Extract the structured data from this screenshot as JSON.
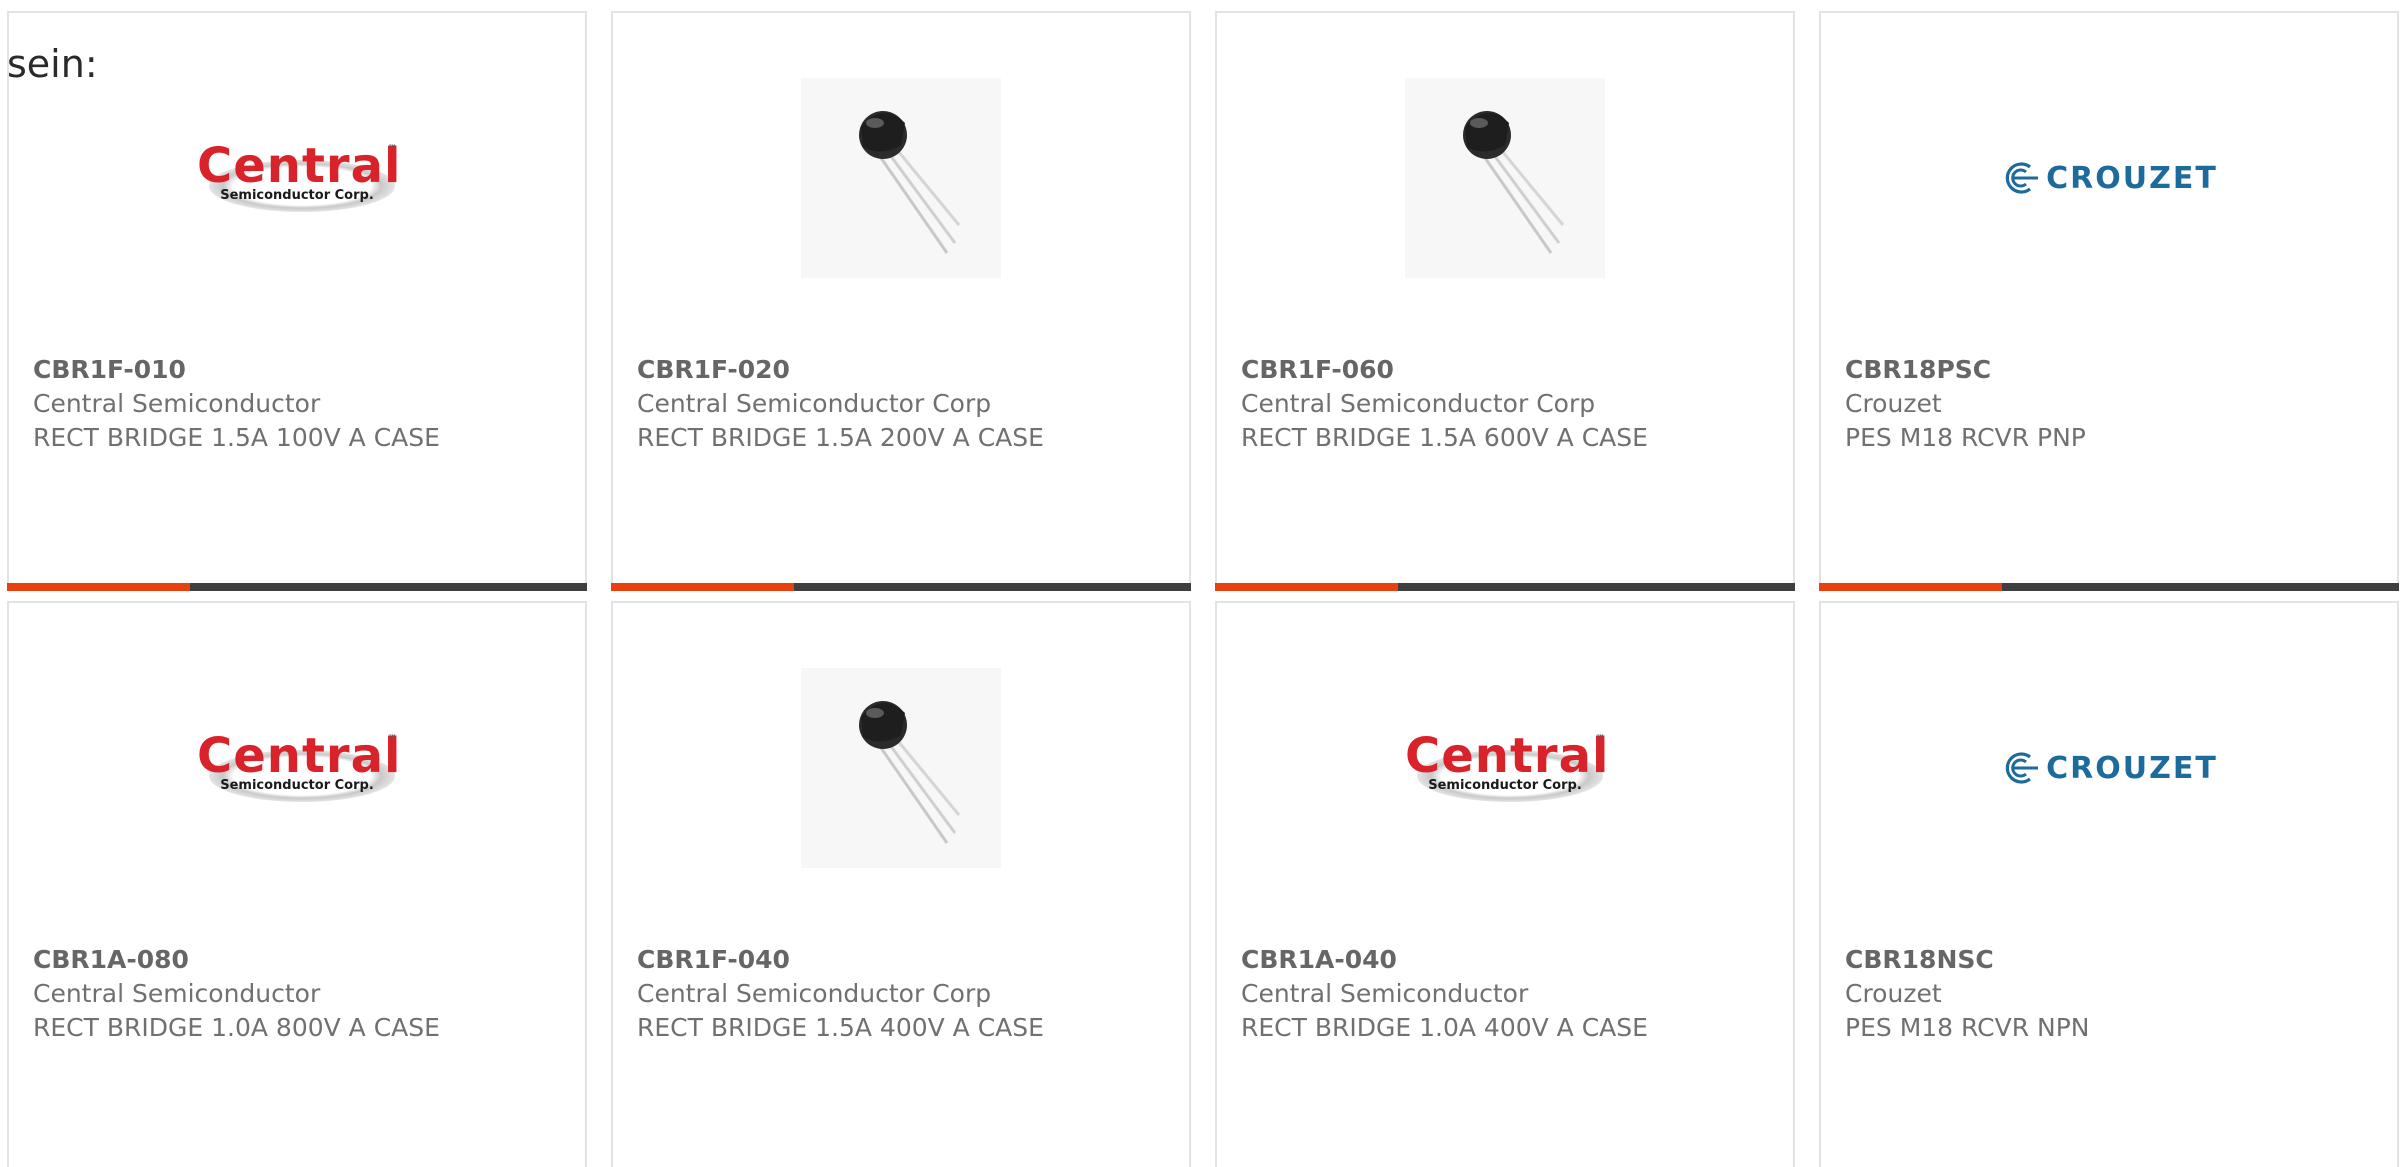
{
  "intro_text": "sein:",
  "colors": {
    "accent": "#e8400f",
    "bar_dark": "#3f3f3f",
    "central_red": "#d8232a",
    "crouzet_blue": "#1d6a9c"
  },
  "products": [
    {
      "part": "CBR1F-010",
      "manufacturer": "Central Semiconductor",
      "description": "RECT BRIDGE 1.5A 100V A CASE",
      "image": "central-logo",
      "logo_word": "Central",
      "logo_sub": "Semiconductor Corp.",
      "logo_tm": "™"
    },
    {
      "part": "CBR1F-020",
      "manufacturer": "Central Semiconductor Corp",
      "description": "RECT BRIDGE 1.5A 200V A CASE",
      "image": "to92-component-photo"
    },
    {
      "part": "CBR1F-060",
      "manufacturer": "Central Semiconductor Corp",
      "description": "RECT BRIDGE 1.5A 600V A CASE",
      "image": "to92-component-photo"
    },
    {
      "part": "CBR18PSC",
      "manufacturer": "Crouzet",
      "description": "PES M18 RCVR PNP",
      "image": "crouzet-logo",
      "logo_word": "CROUZET"
    },
    {
      "part": "CBR1A-080",
      "manufacturer": "Central Semiconductor",
      "description": "RECT BRIDGE 1.0A 800V A CASE",
      "image": "central-logo",
      "logo_word": "Central",
      "logo_sub": "Semiconductor Corp.",
      "logo_tm": "™"
    },
    {
      "part": "CBR1F-040",
      "manufacturer": "Central Semiconductor Corp",
      "description": "RECT BRIDGE 1.5A 400V A CASE",
      "image": "to92-component-photo"
    },
    {
      "part": "CBR1A-040",
      "manufacturer": "Central Semiconductor",
      "description": "RECT BRIDGE 1.0A 400V A CASE",
      "image": "central-logo",
      "logo_word": "Central",
      "logo_sub": "Semiconductor Corp.",
      "logo_tm": "™"
    },
    {
      "part": "CBR18NSC",
      "manufacturer": "Crouzet",
      "description": "PES M18 RCVR NPN",
      "image": "crouzet-logo",
      "logo_word": "CROUZET"
    }
  ]
}
